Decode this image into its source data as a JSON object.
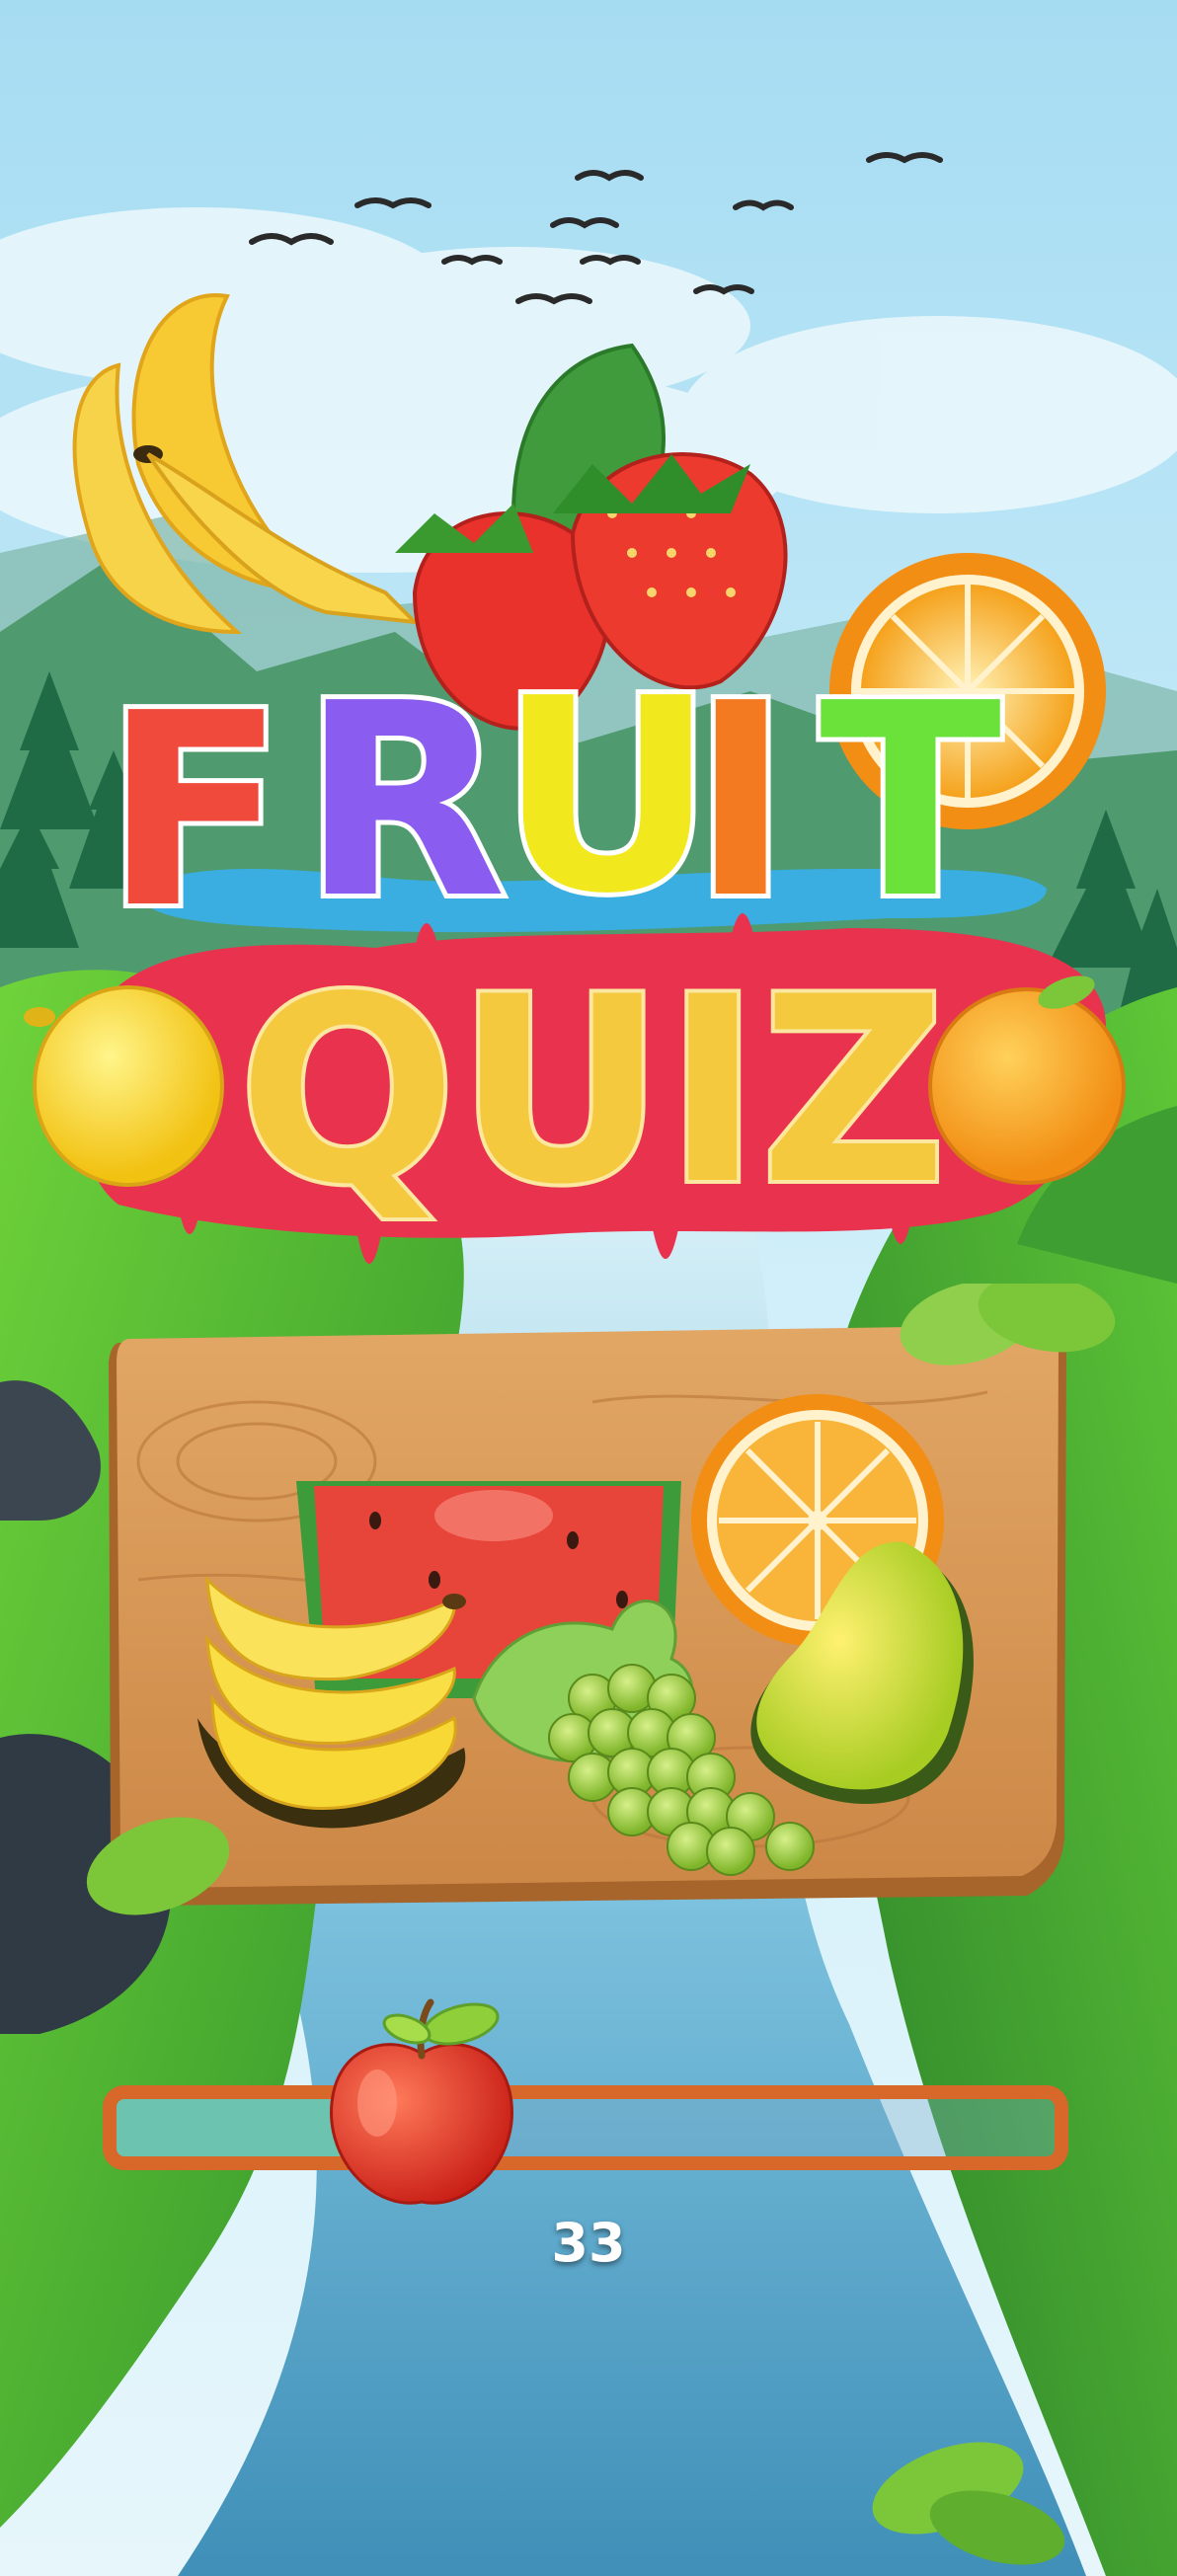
{
  "game": {
    "title_word_1": "FRUIT",
    "title_word_2": "QUIZ",
    "title_letter_colors": [
      "#f04a3c",
      "#8b5cf0",
      "#f2e81e",
      "#f47a22",
      "#6be23a"
    ],
    "quiz_letter_color": "#f5c93d",
    "splash_color": "#e9334e"
  },
  "loading": {
    "progress_value": 33,
    "progress_fraction": 0.33,
    "bar_fill_color": "#6cc4b0",
    "bar_border_color": "#d8672a",
    "indicator_icon": "apple-icon"
  },
  "board_fruits": [
    "watermelon-icon",
    "banana-icon",
    "grapes-icon",
    "orange-slice-icon",
    "pear-icon"
  ],
  "logo_fruits": [
    "banana-icon",
    "strawberry-icon",
    "orange-slice-icon",
    "lemon-icon",
    "orange-icon"
  ]
}
